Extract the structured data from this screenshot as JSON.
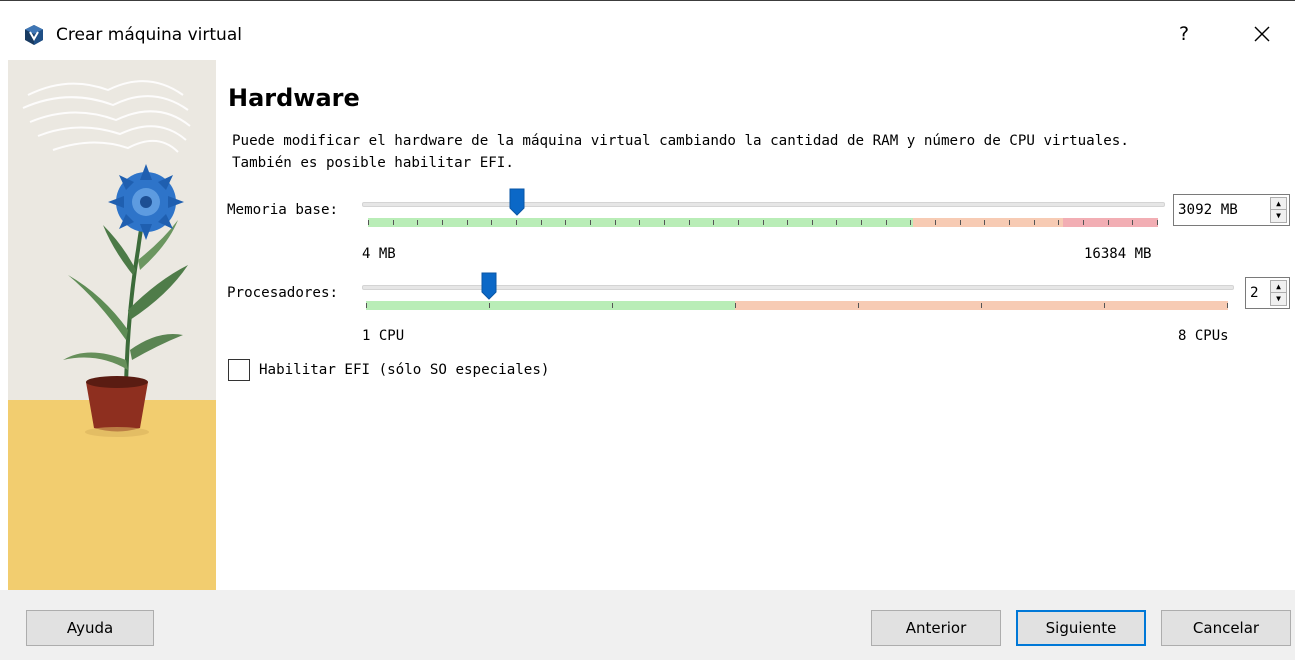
{
  "window": {
    "title": "Crear máquina virtual",
    "help_glyph": "?",
    "close_icon": "close-icon"
  },
  "page": {
    "heading": "Hardware",
    "description_line1": "Puede modificar el hardware de la máquina virtual cambiando la cantidad de RAM y número de CPU virtuales.",
    "description_line2": "También es posible habilitar EFI."
  },
  "memory": {
    "label": "Memoria base:",
    "value": 3092,
    "value_text": "3092 MB",
    "min_label": "4 MB",
    "max_label": "16384 MB",
    "min": 4,
    "max": 16384,
    "recommended_max_fraction": 0.69,
    "warning_max_fraction": 0.88
  },
  "processors": {
    "label": "Procesadores:",
    "value": 2,
    "value_text": "2",
    "min_label": "1 CPU",
    "max_label": "8 CPUs",
    "min": 1,
    "max": 8,
    "recommended_max": 4
  },
  "efi": {
    "label": "Habilitar EFI (sólo SO especiales)",
    "checked": false
  },
  "footer": {
    "help_label": "Ayuda",
    "back_label": "Anterior",
    "next_label": "Siguiente",
    "cancel_label": "Cancelar"
  },
  "colors": {
    "ok": "#b9edb7",
    "warn": "#f7cbb4",
    "danger": "#f2aeb4",
    "thumb": "#0b68c7",
    "default_button_border": "#0078d7"
  }
}
